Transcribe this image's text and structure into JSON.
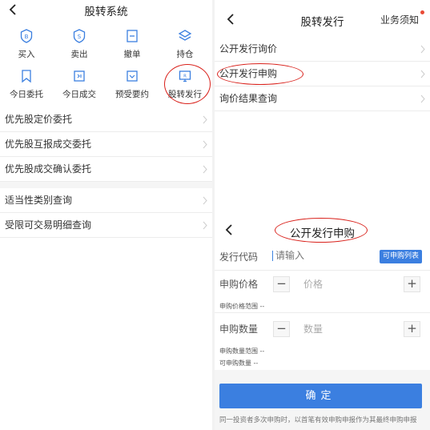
{
  "left": {
    "title": "股转系统",
    "grid": [
      {
        "label": "买入",
        "icon": "buy-icon"
      },
      {
        "label": "卖出",
        "icon": "sell-icon"
      },
      {
        "label": "撤单",
        "icon": "cancel-order-icon"
      },
      {
        "label": "持仓",
        "icon": "holdings-icon"
      },
      {
        "label": "今日委托",
        "icon": "today-orders-icon"
      },
      {
        "label": "今日成交",
        "icon": "today-deals-icon"
      },
      {
        "label": "预受要约",
        "icon": "tender-offer-icon"
      },
      {
        "label": "股转发行",
        "icon": "issuance-icon"
      }
    ],
    "list_group1": [
      "优先股定价委托",
      "优先股互报成交委托",
      "优先股成交确认委托"
    ],
    "list_group2": [
      "适当性类别查询",
      "受限可交易明细查询"
    ]
  },
  "right_top": {
    "title": "股转发行",
    "notice": "业务须知",
    "items": [
      "公开发行询价",
      "公开发行申购",
      "询价结果查询"
    ]
  },
  "right_bottom": {
    "title": "公开发行申购",
    "code_label": "发行代码",
    "code_placeholder": "请输入",
    "list_button": "可申购列表",
    "price_label": "申购价格",
    "price_placeholder": "价格",
    "price_range_label": "申购价格范围",
    "price_range_value": "--",
    "qty_label": "申购数量",
    "qty_placeholder": "数量",
    "qty_range_label": "申购数量范围",
    "qty_range_value": "--",
    "avail_label": "可申购数量",
    "avail_value": "--",
    "minus": "−",
    "plus": "+",
    "confirm": "确定",
    "note": "同一投资者多次申购时，以首笔有效申购申报作为其最终申购申报"
  },
  "colors": {
    "accent": "#3b7fe0",
    "highlight_oval": "#d9211b",
    "badge": "#e94a35"
  }
}
